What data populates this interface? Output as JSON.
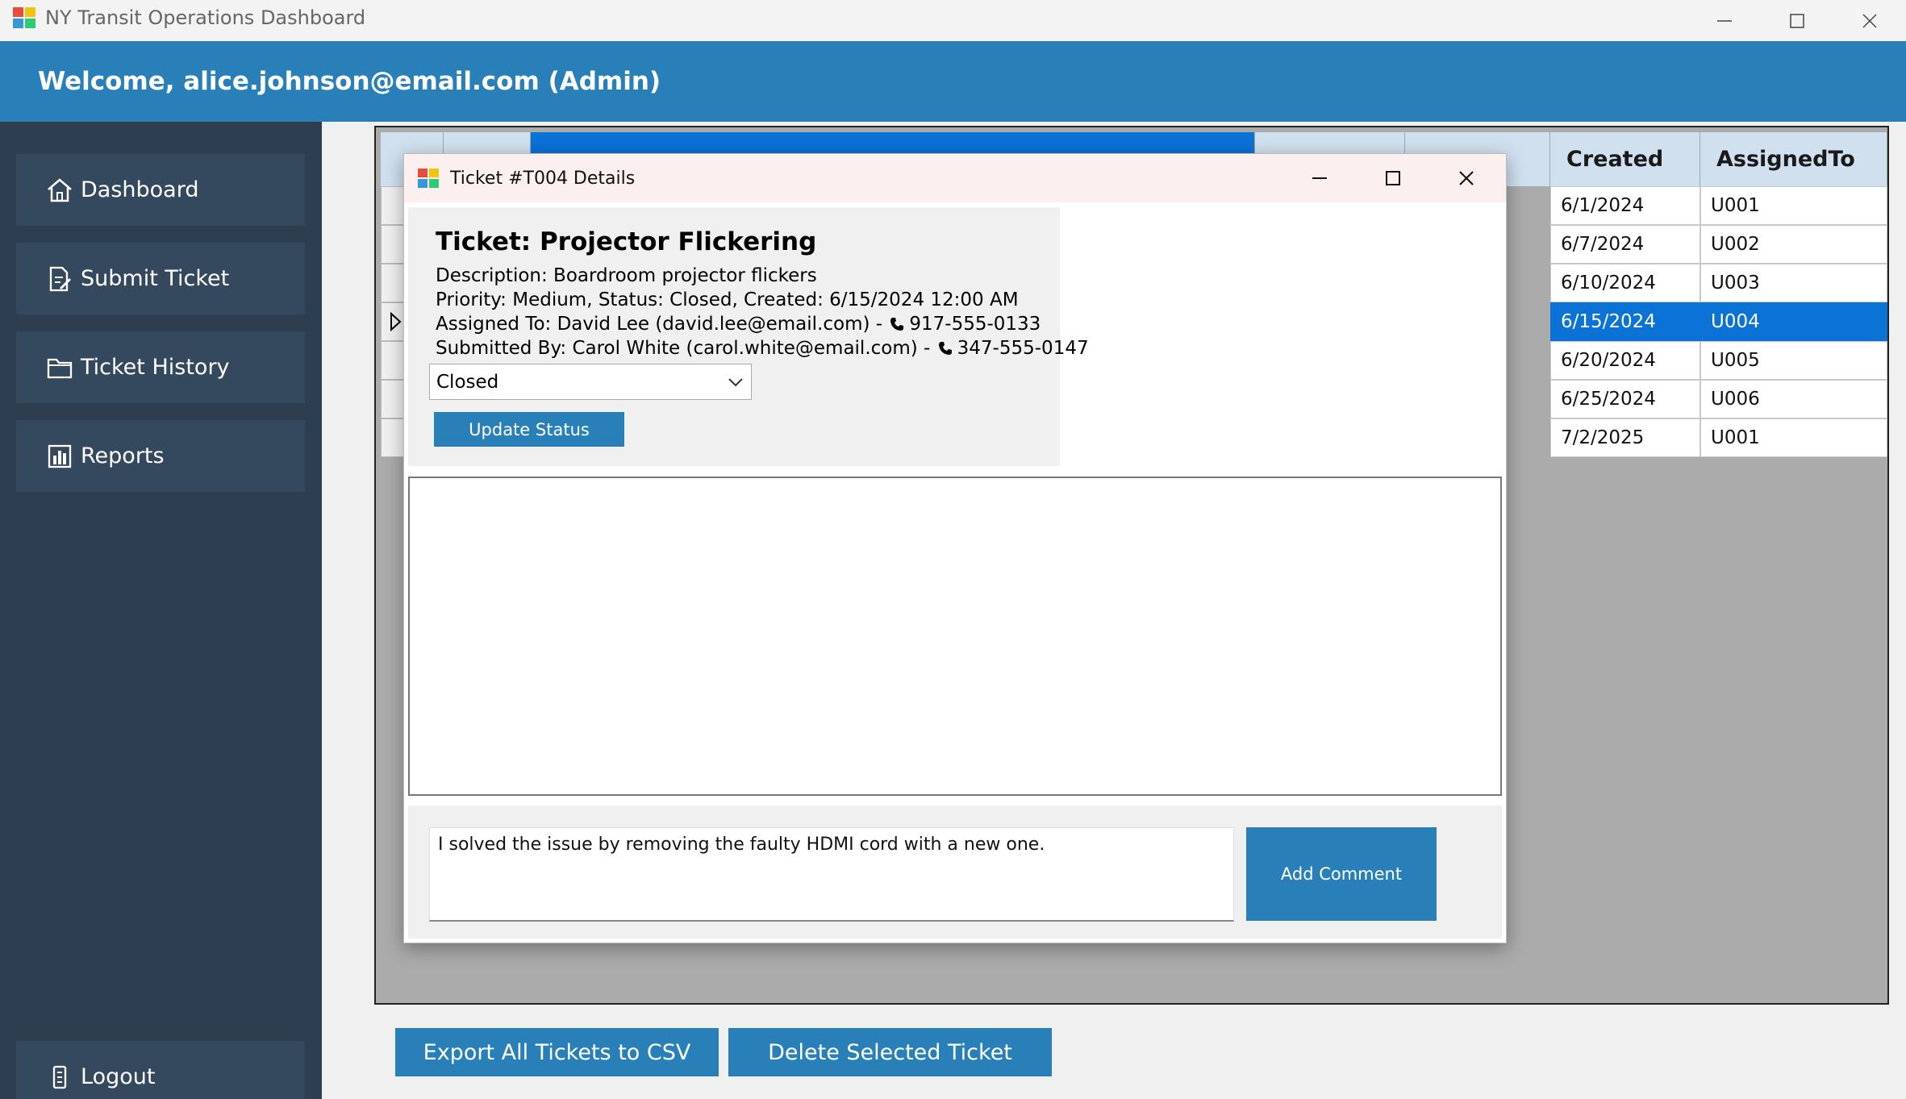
{
  "window": {
    "title": "NY Transit Operations Dashboard"
  },
  "header": {
    "welcome": "Welcome, alice.johnson@email.com (Admin)"
  },
  "sidebar": {
    "items": [
      {
        "label": "Dashboard",
        "icon": "home-icon"
      },
      {
        "label": "Submit Ticket",
        "icon": "edit-document-icon"
      },
      {
        "label": "Ticket History",
        "icon": "folder-icon"
      },
      {
        "label": "Reports",
        "icon": "bar-chart-icon"
      }
    ],
    "logout": {
      "label": "Logout",
      "icon": "logout-icon"
    }
  },
  "grid": {
    "visible_headers": {
      "created": "Created",
      "assigned_to": "AssignedTo"
    },
    "rows": [
      {
        "created": "6/1/2024",
        "assigned": "U001"
      },
      {
        "created": "6/7/2024",
        "assigned": "U002"
      },
      {
        "created": "6/10/2024",
        "assigned": "U003"
      },
      {
        "created": "6/15/2024",
        "assigned": "U004"
      },
      {
        "created": "6/20/2024",
        "assigned": "U005"
      },
      {
        "created": "6/25/2024",
        "assigned": "U006"
      },
      {
        "created": "7/2/2025",
        "assigned": "U001"
      }
    ],
    "selected_row": 3,
    "selection_color": "#0b72d6"
  },
  "actions": {
    "export_label": "Export All Tickets to CSV",
    "delete_label": "Delete Selected Ticket"
  },
  "modal": {
    "title": "Ticket #T004 Details",
    "heading": "Ticket: Projector Flickering",
    "description": "Description: Boardroom projector flickers",
    "priority_status": "Priority: Medium, Status: Closed, Created: 6/15/2024 12:00 AM",
    "assigned_text": "Assigned To: David Lee (david.lee@email.com) - ",
    "assigned_phone": "917-555-0133",
    "submitted_text": "Submitted By: Carol White (carol.white@email.com) - ",
    "submitted_phone": "347-555-0147",
    "status_value": "Closed",
    "update_button": "Update Status",
    "comment_text": "I solved the issue by removing the faulty HDMI cord with a new one.",
    "add_comment_button": "Add Comment"
  },
  "colors": {
    "header": "#2980b9",
    "sidebar": "#2c3e50",
    "sidebar_button": "#34495e",
    "accent_button": "#2980b9"
  }
}
